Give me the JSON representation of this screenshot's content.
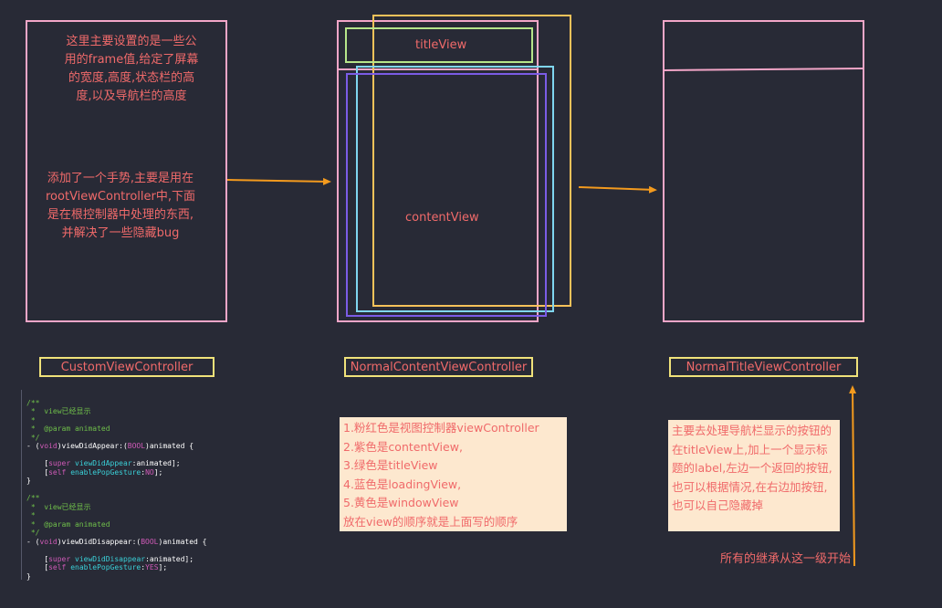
{
  "custom": {
    "note1": "这里主要设置的是一些公用的frame值,给定了屏幕的宽度,高度,状态栏的高度,以及导航栏的高度",
    "note2": "添加了一个手势,主要是用在rootViewController中,下面是在根控制器中处理的东西,并解决了一些隐藏bug",
    "label": "CustomViewController"
  },
  "content": {
    "title_view": "titleView",
    "content_view": "contentView",
    "label": "NormalContentViewController",
    "legend": [
      "1.粉红色是视图控制器viewController",
      "2.紫色是contentView,",
      "3.绿色是titleView",
      "4.蓝色是loadingView,",
      "5.黄色是windowView",
      "放在view的顺序就是上面写的顺序"
    ]
  },
  "title": {
    "label": "NormalTitleViewController",
    "note": "主要去处理导航栏显示的按钮的在titleView上,加上一个显示标题的label,左边一个返回的按钮,也可以根据情况,在右边加按钮,也可以自己隐藏掉",
    "inherit_note": "所有的继承从这一级开始"
  },
  "code": {
    "appear": {
      "c1": "/**",
      "c2": " *  view已经显示",
      "c3": " *",
      "c4": " *  @param animated",
      "c5": " */",
      "sig_a": "- (",
      "sig_void": "void",
      "sig_b": ")viewDidAppear:(",
      "sig_bool": "BOOL",
      "sig_c": ")animated {",
      "l1_kw": "super",
      "l1_fn": "viewDidAppear",
      "l1_rest": ":animated];",
      "l2_kw": "self",
      "l2_fn": "enablePopGesture",
      "l2_colon": ":",
      "l2_val": "NO",
      "l2_end": "];",
      "close": "}"
    },
    "disappear": {
      "c1": "/**",
      "c2": " *  view已经显示",
      "c3": " *",
      "c4": " *  @param animated",
      "c5": " */",
      "sig_a": "- (",
      "sig_void": "void",
      "sig_b": ")viewDidDisappear:(",
      "sig_bool": "BOOL",
      "sig_c": ")animated {",
      "l1_kw": "super",
      "l1_fn": "viewDidDisappear",
      "l1_rest": ":animated];",
      "l2_kw": "self",
      "l2_fn": "enablePopGesture",
      "l2_colon": ":",
      "l2_val": "YES",
      "l2_end": "];",
      "close": "}"
    }
  },
  "colors": {
    "pink": "#f3a6c8",
    "purple": "#7b5ce6",
    "green": "#b6e58a",
    "blue": "#7fd6f0",
    "yellow": "#f7c25a",
    "arrow": "#f39a1e"
  }
}
